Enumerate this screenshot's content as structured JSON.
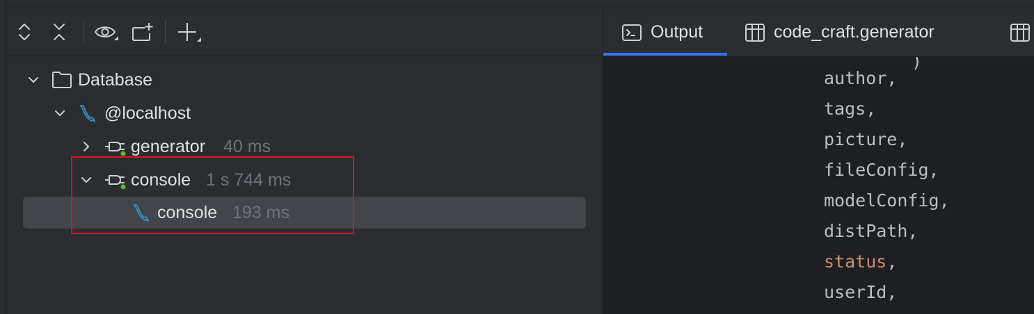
{
  "toolbar": {
    "expand_all_icon": "expand-all-icon",
    "collapse_all_icon": "collapse-all-icon",
    "view_options_icon": "eye-icon",
    "new_session_icon": "new-console-icon",
    "add_icon": "plus-icon"
  },
  "tree": {
    "root": {
      "label": "Database",
      "icon": "folder-icon"
    },
    "host": {
      "label": "@localhost",
      "icon": "mysql-dolphin-icon"
    },
    "items": [
      {
        "label": "generator",
        "meta": "40 ms",
        "icon": "connection-plug-icon",
        "expanded": false
      },
      {
        "label": "console",
        "meta": "1 s 744 ms",
        "icon": "connection-plug-icon",
        "expanded": true
      },
      {
        "label": "console",
        "meta": "193 ms",
        "icon": "mysql-dolphin-icon",
        "selected": true
      }
    ]
  },
  "tabs": [
    {
      "label": "Output",
      "icon": "terminal-icon",
      "active": true
    },
    {
      "label": "code_craft.generator",
      "icon": "table-icon",
      "active": false
    },
    {
      "label": "",
      "icon": "table-icon",
      "active": false
    }
  ],
  "code": {
    "lines": [
      {
        "text": "author,",
        "keyword": false
      },
      {
        "text": "tags,",
        "keyword": false
      },
      {
        "text": "picture,",
        "keyword": false
      },
      {
        "text": "fileConfig,",
        "keyword": false
      },
      {
        "text": "modelConfig,",
        "keyword": false
      },
      {
        "text": "distPath,",
        "keyword": false
      },
      {
        "kw": "status",
        "text": ",",
        "keyword": true
      },
      {
        "text": "userId,",
        "keyword": false
      }
    ]
  },
  "colors": {
    "accent": "#3574f0",
    "highlight_border": "#e0111b",
    "keyword": "#cf8e6d",
    "status_dot": "#5fb832",
    "mysql_icon": "#3592c4"
  }
}
